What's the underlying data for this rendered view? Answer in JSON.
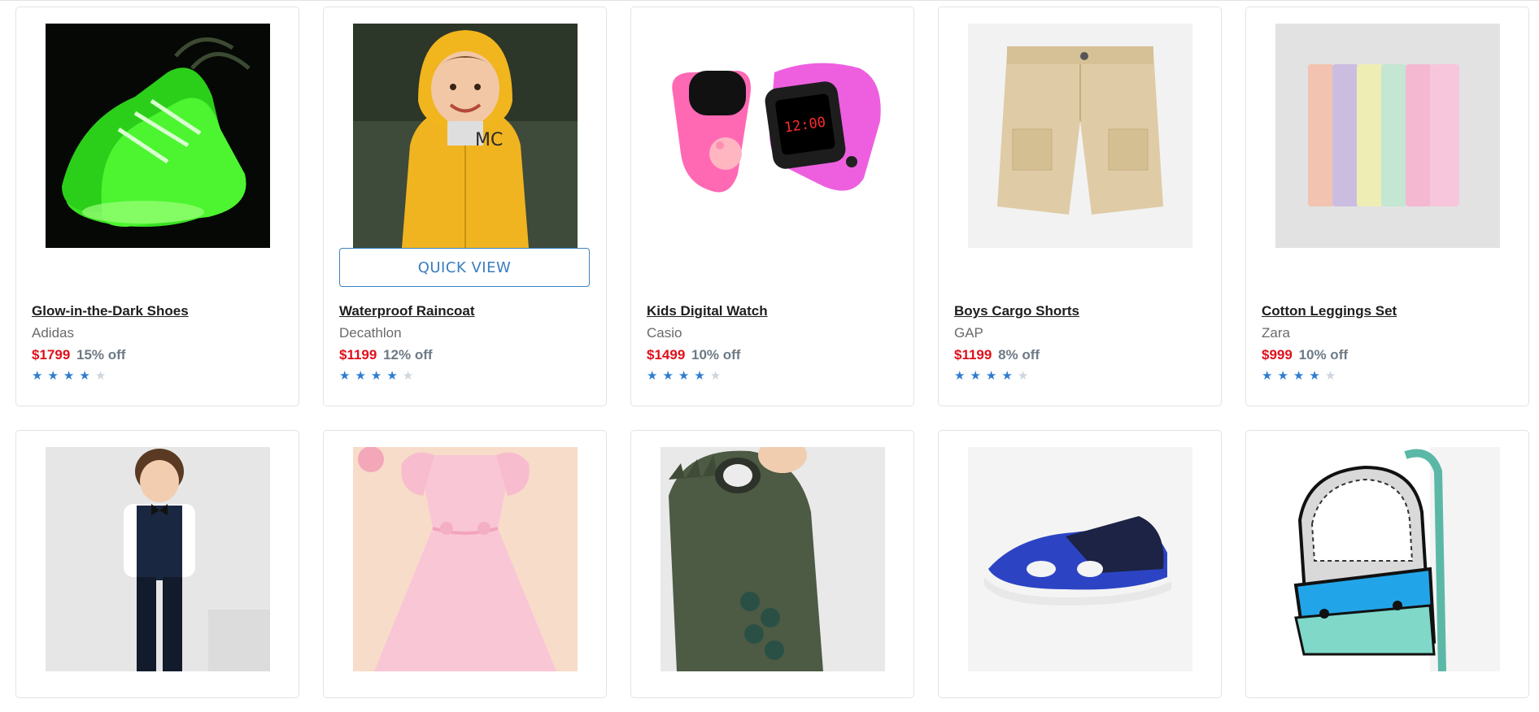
{
  "products": [
    {
      "name": "Glow-in-the-Dark Shoes",
      "brand": "Adidas",
      "price": "$1799",
      "discount": "15% off",
      "rating": 4,
      "image": "glow-shoes-image"
    },
    {
      "name": "Waterproof Raincoat",
      "brand": "Decathlon",
      "price": "$1199",
      "discount": "12% off",
      "rating": 4,
      "image": "raincoat-image",
      "quick_view": "QUICK VIEW"
    },
    {
      "name": "Kids Digital Watch",
      "brand": "Casio",
      "price": "$1499",
      "discount": "10% off",
      "rating": 4,
      "image": "digital-watch-image"
    },
    {
      "name": "Boys Cargo Shorts",
      "brand": "GAP",
      "price": "$1199",
      "discount": "8% off",
      "rating": 4,
      "image": "cargo-shorts-image"
    },
    {
      "name": "Cotton Leggings Set",
      "brand": "Zara",
      "price": "$999",
      "discount": "10% off",
      "rating": 4,
      "image": "leggings-set-image"
    },
    {
      "image": "boy-suit-image"
    },
    {
      "image": "pink-dress-image"
    },
    {
      "image": "dino-hoodie-image"
    },
    {
      "image": "sandal-image"
    },
    {
      "image": "backpack-image"
    }
  ],
  "star_glyph": "★",
  "colors": {
    "price": "#e0101b",
    "star_on": "#2e7bd0",
    "star_off": "#cfd6de",
    "quick_view": "#3a7cc0"
  }
}
